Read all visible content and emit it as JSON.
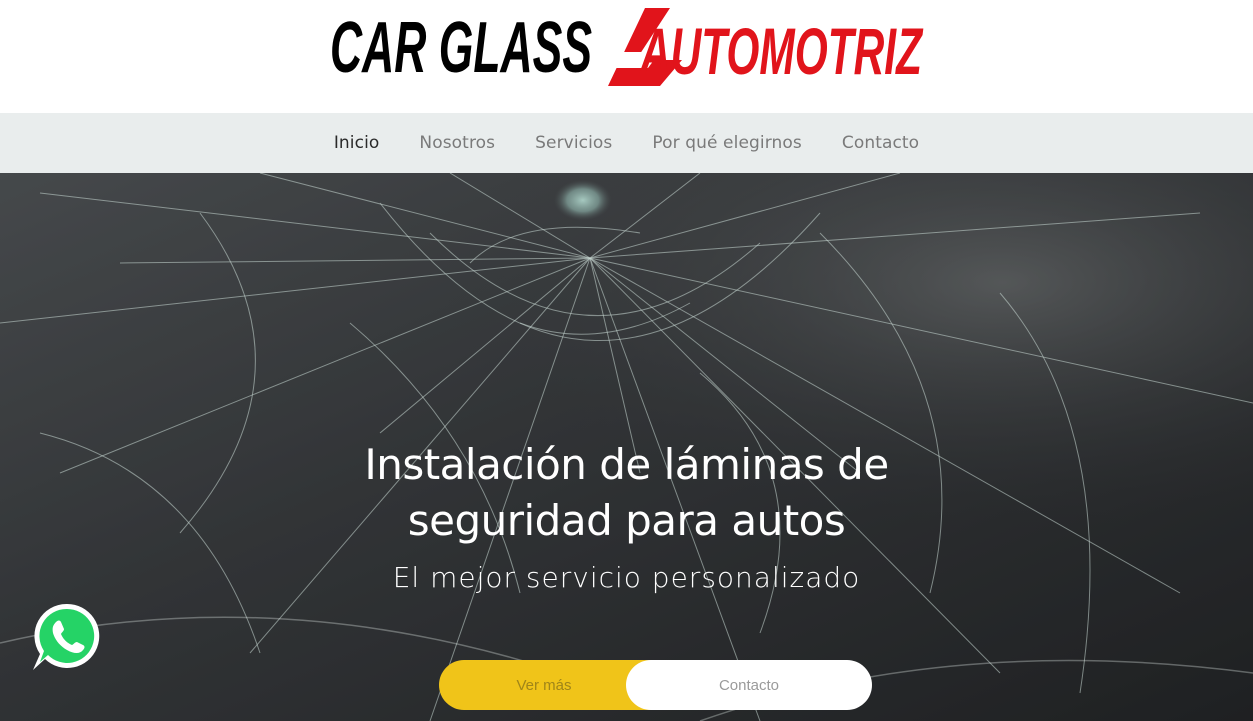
{
  "logo": {
    "part1": "CAR GLASS",
    "part2": "AUTOMOTRIZ",
    "color_primary": "#000000",
    "color_accent": "#e1141b"
  },
  "nav": {
    "items": [
      {
        "label": "Inicio",
        "active": true
      },
      {
        "label": "Nosotros",
        "active": false
      },
      {
        "label": "Servicios",
        "active": false
      },
      {
        "label": "Por qué elegirnos",
        "active": false
      },
      {
        "label": "Contacto",
        "active": false
      }
    ]
  },
  "hero": {
    "title_line1": "Instalación de láminas de",
    "title_line2": "seguridad para autos",
    "subtitle": "El mejor servicio personalizado",
    "btn_primary": "Ver más",
    "btn_secondary": "Contacto",
    "btn_primary_color": "#f0c419"
  },
  "floating": {
    "icon": "whatsapp-icon",
    "color": "#25d366"
  }
}
